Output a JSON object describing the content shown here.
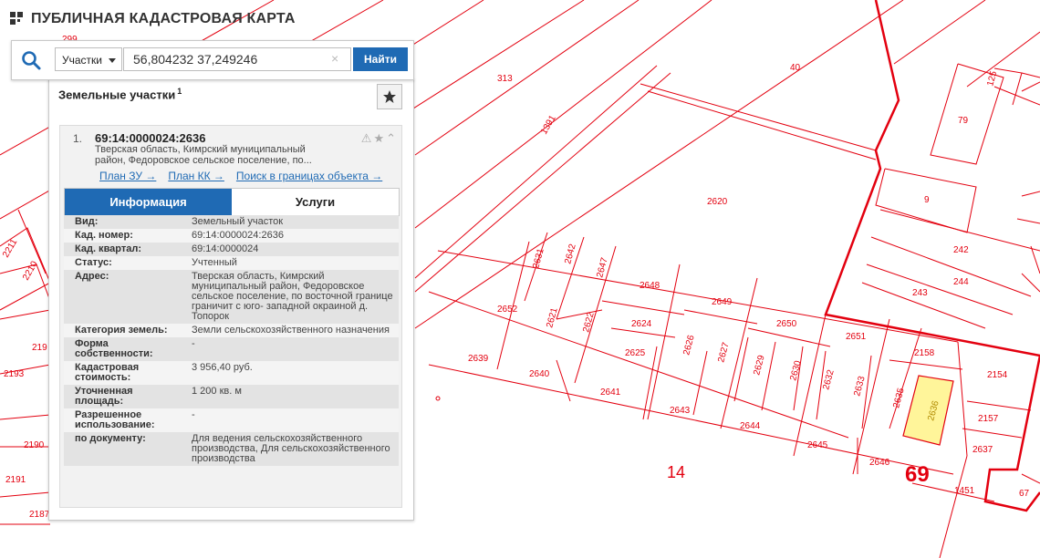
{
  "header": {
    "title": "ПУБЛИЧНАЯ КАДАСТРОВАЯ КАРТА"
  },
  "search": {
    "type_label": "Участки",
    "query": "56,804232 37,249246",
    "clear_glyph": "×",
    "find_label": "Найти"
  },
  "panel": {
    "title": "Земельные участки",
    "count": "1",
    "item": {
      "index": "1.",
      "cadastral_number": "69:14:0000024:2636",
      "address_short": "Тверская область, Кимрский муниципальный район, Федоровское сельское поселение, по...",
      "links": [
        "План ЗУ →",
        "План КК →",
        "Поиск в границах объекта →"
      ]
    },
    "tabs": [
      {
        "label": "Информация",
        "active": true
      },
      {
        "label": "Услуги",
        "active": false
      }
    ],
    "attributes": [
      {
        "key": "Вид:",
        "value": "Земельный участок"
      },
      {
        "key": "Кад. номер:",
        "value": "69:14:0000024:2636",
        "link": true
      },
      {
        "key": "Кад. квартал:",
        "value": "69:14:0000024",
        "link": true
      },
      {
        "key": "Статус:",
        "value": "Учтенный"
      },
      {
        "key": "Адрес:",
        "value": "Тверская область, Кимрский муниципальный район, Федоровское сельское поселение, по восточной границе граничит с юго- западной окраиной д. Топорок"
      },
      {
        "key": "Категория земель:",
        "value": "Земли сельскохозяйственного назначения"
      },
      {
        "key": "Форма собственности:",
        "value": "-"
      },
      {
        "key": "Кадастровая стоимость:",
        "value": "3 956,40 руб."
      },
      {
        "key": "Уточненная площадь:",
        "value": "1 200 кв. м"
      },
      {
        "key": "Разрешенное использование:",
        "value": "-"
      },
      {
        "key": "по документу:",
        "value": "Для ведения сельскохозяйственного производства, Для сельскохозяйственного производства"
      }
    ]
  },
  "map": {
    "parcel_color": "#e3000f",
    "selected_fill": "#fff59a",
    "selected_parcel": "2636",
    "labels": [
      "313",
      "40",
      "125",
      "79",
      "1391",
      "2620",
      "9",
      "242",
      "244",
      "243",
      "2631",
      "2642",
      "2647",
      "2648",
      "2649",
      "2650",
      "2651",
      "2652",
      "2621",
      "2622",
      "2624",
      "2625",
      "2626",
      "2627",
      "2629",
      "2630",
      "2632",
      "2633",
      "2635",
      "2636",
      "2158",
      "2154",
      "2157",
      "2637",
      "2639",
      "2640",
      "2641",
      "2643",
      "2644",
      "2645",
      "2646",
      "1451",
      "67",
      "14",
      "69",
      "2211",
      "2210",
      "2193",
      "219",
      "2190",
      "2191",
      "2187",
      "299"
    ]
  }
}
